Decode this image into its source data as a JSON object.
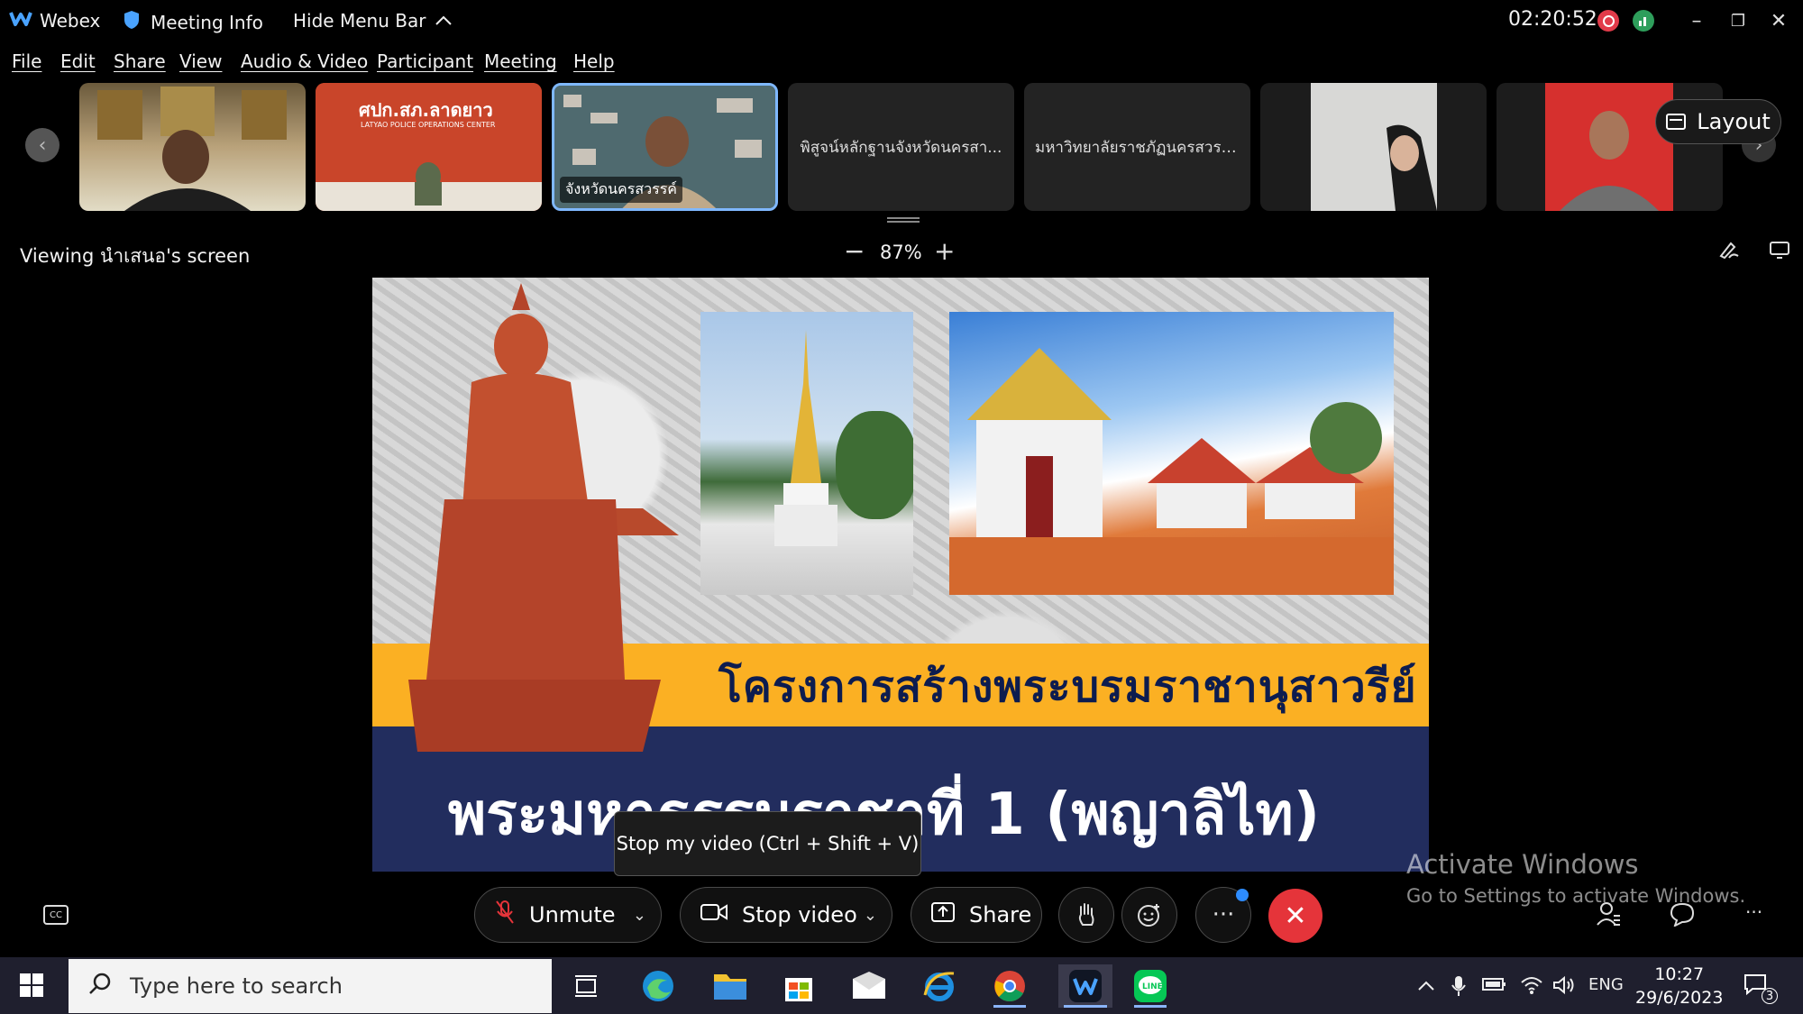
{
  "titlebar": {
    "app_name": "Webex",
    "meeting_info": "Meeting Info",
    "hide_menu": "Hide Menu Bar",
    "timer": "02:20:52",
    "minimize": "–",
    "restore": "❐",
    "close": "✕"
  },
  "menu": {
    "items": [
      "File",
      "Edit",
      "Share",
      "View",
      "Audio & Video",
      "Participant",
      "Meeting",
      "Help"
    ]
  },
  "filmstrip": {
    "tiles": [
      {
        "label": ""
      },
      {
        "label": ""
      },
      {
        "label": "จังหวัดนครสวรรค์"
      },
      {
        "label": "พิสูจน์หลักฐานจังหวัดนครสา..."
      },
      {
        "label": "มหาวิทยาลัยราชภัฏนครสวรรค์"
      },
      {
        "label": ""
      },
      {
        "label": ""
      }
    ],
    "tile2_sign": "ศปก.สภ.ลาดยาว",
    "tile2_sub": "LATYAO POLICE OPERATIONS CENTER",
    "layout_label": "Layout"
  },
  "viewing": {
    "text": "Viewing นำเสนอ's screen",
    "zoom": "87%"
  },
  "slide": {
    "title_line1": "โครงการสร้างพระบรมราชานุสาวรีย์",
    "title_line2": "พระมหาธรรมราชาที่ 1 (พญาลิไท)"
  },
  "tooltip": "Stop my video (Ctrl + Shift + V)",
  "watermark": {
    "line1": "Activate Windows",
    "line2": "Go to Settings to activate Windows."
  },
  "controls": {
    "unmute": "Unmute",
    "stop_video": "Stop video",
    "share": "Share"
  },
  "taskbar": {
    "search_placeholder": "Type here to search",
    "lang": "ENG",
    "time": "10:27",
    "date": "29/6/2023",
    "notifications": "3"
  },
  "colors": {
    "end_call": "#e5343a",
    "active_tile_border": "#7fb8ff",
    "slide_yellow": "#fbb023",
    "slide_navy": "#222d5e"
  }
}
